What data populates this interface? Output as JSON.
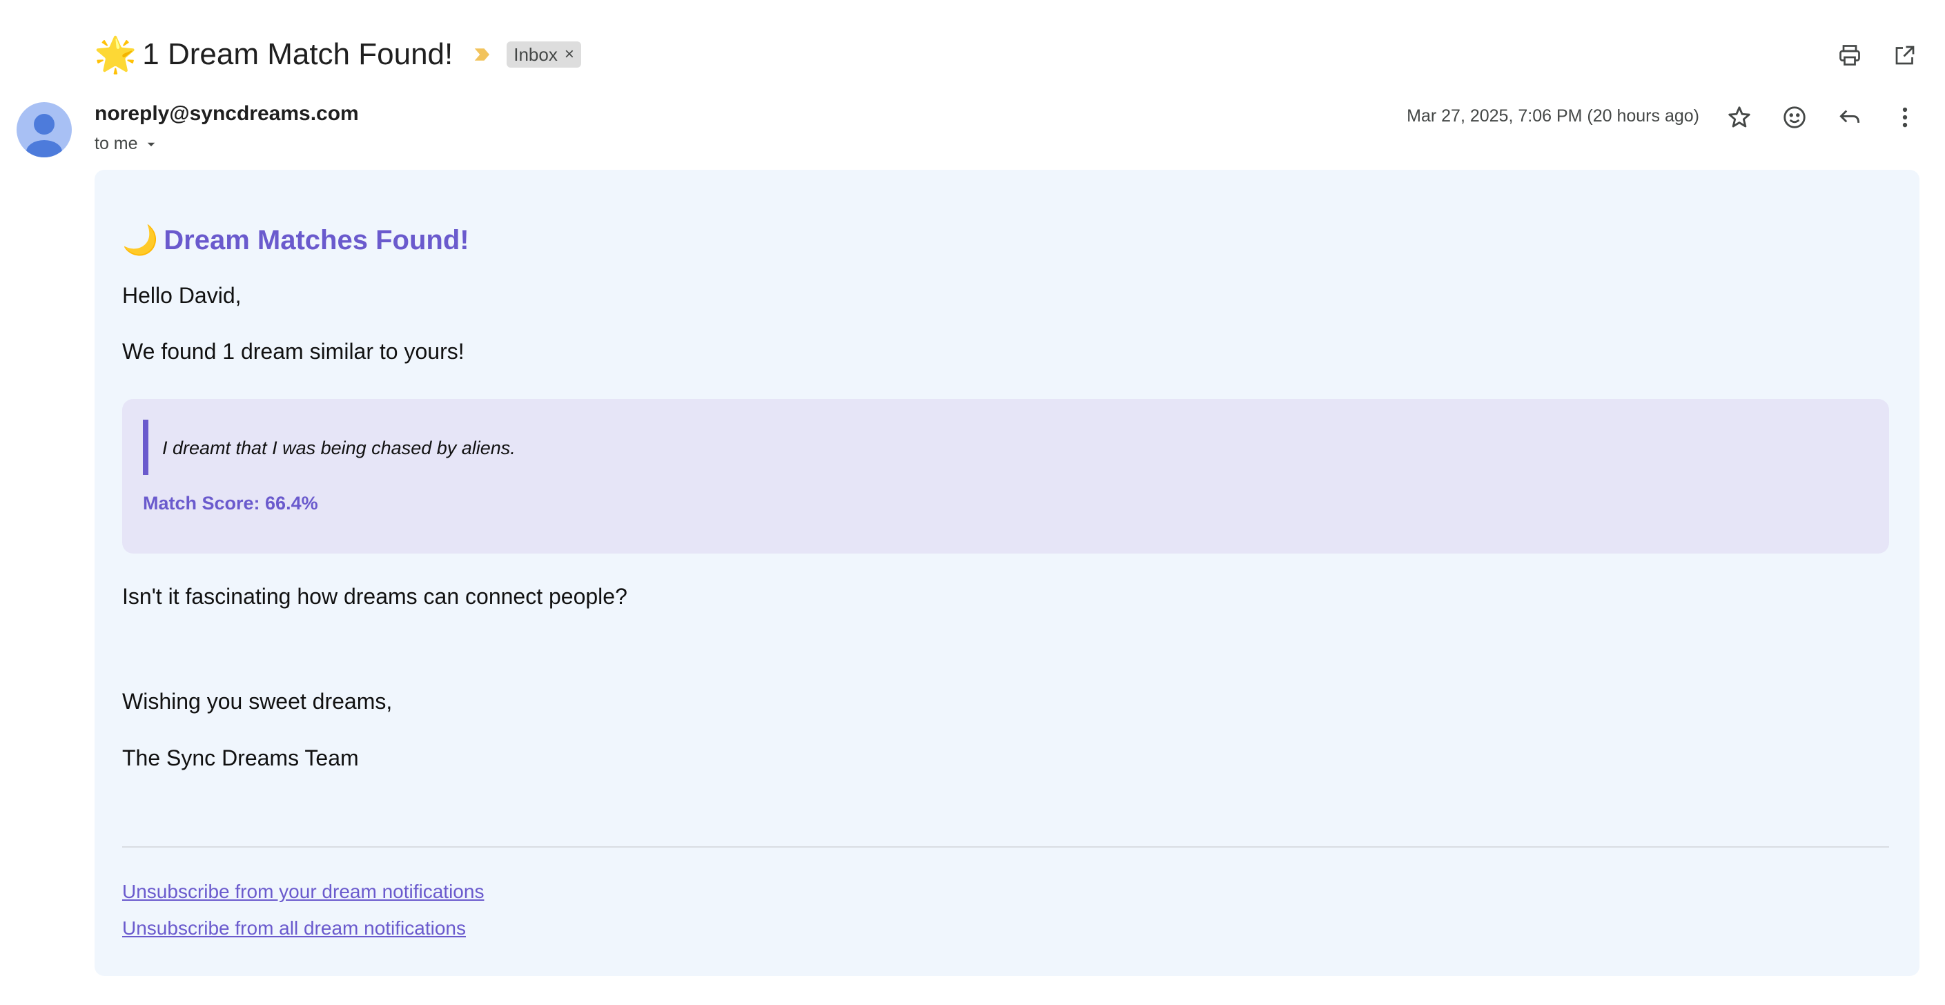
{
  "subject": {
    "emoji": "🌟",
    "text": "1 Dream Match Found!",
    "label": "Inbox",
    "label_close": "×"
  },
  "colors": {
    "accent": "#6a5acd",
    "card_bg": "#f0f6fd",
    "quote_bg": "#e6e5f7",
    "importance": "#f2c35c",
    "avatar_bg": "#a8c0f4",
    "avatar_fg": "#4d7bdb"
  },
  "icons": {
    "top": [
      "print-icon",
      "open-in-new-window-icon"
    ],
    "message": [
      "star-icon",
      "emoji-reaction-icon",
      "reply-icon",
      "more-vert-icon"
    ]
  },
  "header": {
    "sender": "noreply@syncdreams.com",
    "to": "to me",
    "date": "Mar 27, 2025, 7:06 PM (20 hours ago)"
  },
  "body": {
    "heading_emoji": "🌙",
    "heading": "Dream Matches Found!",
    "greeting": "Hello David,",
    "intro": "We found 1 dream similar to yours!",
    "dream_quote": "I dreamt that I was being chased by aliens.",
    "match_score": "Match Score: 66.4%",
    "closing_question": "Isn't it fascinating how dreams can connect people?",
    "signoff": "Wishing you sweet dreams,",
    "signature": "The Sync Dreams Team"
  },
  "footer": {
    "unsubscribe_yours": "Unsubscribe from your dream notifications",
    "unsubscribe_all": "Unsubscribe from all dream notifications"
  }
}
